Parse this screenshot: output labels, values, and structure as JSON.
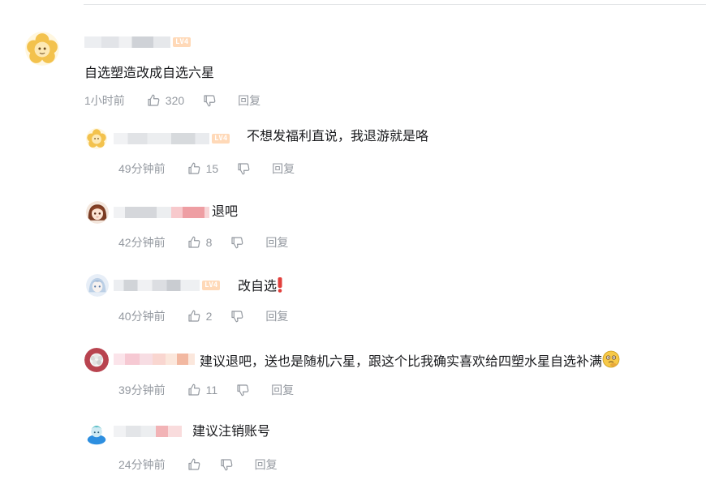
{
  "comments": [
    {
      "level": "LV4",
      "text": "自选塑造改成自选六星",
      "time": "1小时前",
      "likes": "320",
      "reply_label": "回复",
      "avatar_icon": "yellow-flower-avatar-icon"
    },
    {
      "level": "LV4",
      "text": "不想发福利直说，我退游就是咯",
      "time": "49分钟前",
      "likes": "15",
      "reply_label": "回复",
      "avatar_icon": "yellow-flower-avatar-icon"
    },
    {
      "level": "",
      "text": "退吧",
      "time": "42分钟前",
      "likes": "8",
      "reply_label": "回复",
      "avatar_icon": "anime-girl-avatar-icon"
    },
    {
      "level": "LV4",
      "text": "改自选",
      "time": "40分钟前",
      "likes": "2",
      "reply_label": "回复",
      "avatar_icon": "anime-character-avatar-icon"
    },
    {
      "level": "",
      "text": "建议退吧，送也是随机六星，跟这个比我确实喜欢给四塑水星自选补满",
      "time": "39分钟前",
      "likes": "11",
      "reply_label": "回复",
      "avatar_icon": "pink-circle-avatar-icon"
    },
    {
      "level": "",
      "text": "建议注销账号",
      "time": "24分钟前",
      "likes": "",
      "reply_label": "回复",
      "avatar_icon": "blue-character-avatar-icon"
    }
  ],
  "icons": {
    "like": "thumbs-up-icon",
    "dislike": "thumbs-down-icon",
    "exclamation": "red-exclamation-icon",
    "thinking": "thinking-face-icon"
  },
  "colors": {
    "text": "#18191c",
    "meta": "#9499a0",
    "level_badge": "#ffd9b8"
  }
}
